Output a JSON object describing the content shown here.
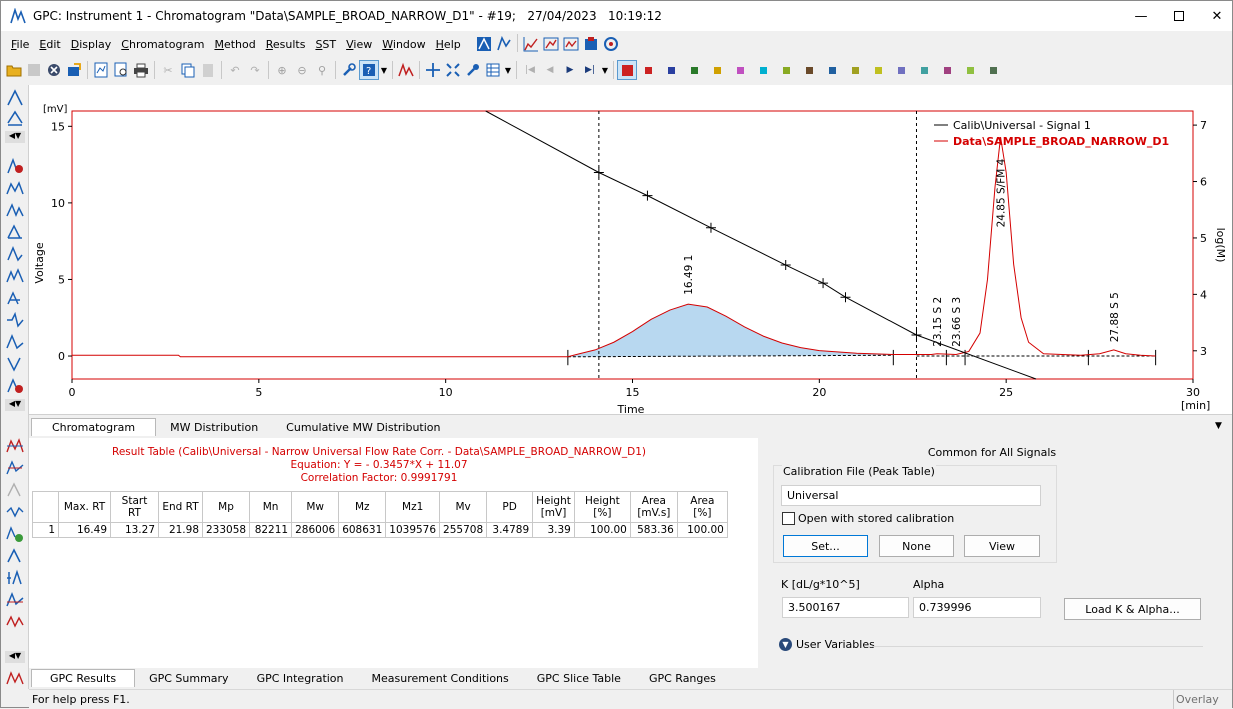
{
  "window": {
    "title": "GPC: Instrument 1 - Chromatogram \"Data\\SAMPLE_BROAD_NARROW_D1\" - #19;   27/04/2023   10:19:12"
  },
  "menu": [
    {
      "label": "File",
      "u": "F"
    },
    {
      "label": "Edit",
      "u": "E"
    },
    {
      "label": "Display",
      "u": "D"
    },
    {
      "label": "Chromatogram",
      "u": "C"
    },
    {
      "label": "Method",
      "u": "M"
    },
    {
      "label": "Results",
      "u": "R"
    },
    {
      "label": "SST",
      "u": "S"
    },
    {
      "label": "View",
      "u": "V"
    },
    {
      "label": "Window",
      "u": "W"
    },
    {
      "label": "Help",
      "u": "H"
    }
  ],
  "colors": {
    "signal_red": "#d40000",
    "accent_blue": "#1a5fb4",
    "fill_blue": "#b8d8f0",
    "result_red": "#d40000",
    "palette": [
      "#cc2222",
      "#2a3fa0",
      "#2a7a2a",
      "#d0a000",
      "#c050c0",
      "#00b0d0",
      "#88aa22",
      "#6a4a2a",
      "#2060a0",
      "#a0a020",
      "#c0c020",
      "#7070c0",
      "#40a0a0",
      "#a04080",
      "#90c040",
      "#507050"
    ]
  },
  "chart": {
    "y_left_unit": "[mV]",
    "y_left_label": "Voltage",
    "y_right_label": "log(M)",
    "x_label": "Time",
    "x_unit": "[min]",
    "x_ticks": [
      "0",
      "5",
      "10",
      "15",
      "20",
      "25",
      "30"
    ],
    "y_ticks": [
      "0",
      "5",
      "10",
      "15"
    ],
    "y2_ticks": [
      "3",
      "4",
      "5",
      "6",
      "7"
    ],
    "legend": [
      "Calib\\Universal - Signal 1",
      "Data\\SAMPLE_BROAD_NARROW_D1"
    ],
    "peak_labels": [
      {
        "rt": "16.49",
        "name": "1"
      },
      {
        "rt": "23.15",
        "name": "S 2"
      },
      {
        "rt": "23.66",
        "name": "S 3"
      },
      {
        "rt": "24.85",
        "name": "S/FM 4"
      },
      {
        "rt": "27.88",
        "name": "S 5"
      }
    ]
  },
  "chart_data": {
    "type": "line",
    "xlim": [
      0,
      30
    ],
    "ylim": [
      -1.5,
      16
    ],
    "y2lim": [
      2.5,
      7.25
    ],
    "series": [
      {
        "name": "Calib\\Universal - Signal 1",
        "axis": "right",
        "x": [
          11.07,
          14.1,
          15.4,
          17.1,
          19.1,
          20.1,
          20.7,
          22.6,
          25.8
        ],
        "y": [
          7.25,
          6.16,
          5.75,
          5.18,
          4.52,
          4.2,
          3.95,
          3.28,
          2.5
        ]
      },
      {
        "name": "Data\\SAMPLE_BROAD_NARROW_D1",
        "axis": "left",
        "x": [
          0,
          2.85,
          2.9,
          13.27,
          13.5,
          14.0,
          14.5,
          15.0,
          15.5,
          16.0,
          16.49,
          17.0,
          17.5,
          18.0,
          18.5,
          19.0,
          19.5,
          20.0,
          21.0,
          21.98,
          23.0,
          23.15,
          23.66,
          24.0,
          24.3,
          24.5,
          24.7,
          24.85,
          25.0,
          25.2,
          25.4,
          25.6,
          26.0,
          27.0,
          27.5,
          27.88,
          28.2,
          28.6,
          29.0
        ],
        "y": [
          0.05,
          0.05,
          -0.05,
          -0.05,
          0.1,
          0.4,
          0.9,
          1.6,
          2.4,
          3.0,
          3.39,
          3.2,
          2.6,
          1.9,
          1.3,
          0.85,
          0.55,
          0.35,
          0.18,
          0.1,
          0.1,
          0.15,
          0.1,
          0.3,
          1.5,
          5.0,
          11.0,
          14.3,
          12.0,
          6.0,
          2.5,
          0.9,
          0.15,
          0.05,
          0.15,
          0.4,
          0.15,
          0.05,
          0.0
        ]
      }
    ],
    "markers_x": [
      14.1,
      15.4,
      17.1,
      19.1,
      20.1,
      20.7,
      22.6
    ],
    "dashed_vlines": [
      14.1,
      22.6
    ]
  },
  "tabs_top": [
    "Chromatogram",
    "MW Distribution",
    "Cumulative MW Distribution"
  ],
  "result": {
    "line1": "Result Table (Calib\\Universal - Narrow Universal Flow Rate Corr. - Data\\SAMPLE_BROAD_NARROW_D1)",
    "line2": "Equation: Y =  - 0.3457*X + 11.07",
    "line3": "Correlation Factor: 0.9991791",
    "headers": [
      "",
      "Max. RT",
      "Start RT",
      "End RT",
      "Mp",
      "Mn",
      "Mw",
      "Mz",
      "Mz1",
      "Mv",
      "PD",
      "Height [mV]",
      "Height [%]",
      "Area [mV.s]",
      "Area [%]"
    ],
    "rows": [
      [
        "1",
        "16.49",
        "13.27",
        "21.98",
        "233058",
        "82211",
        "286006",
        "608631",
        "1039576",
        "255708",
        "3.4789",
        "3.39",
        "100.00",
        "583.36",
        "100.00"
      ]
    ]
  },
  "calib": {
    "title": "Common for All Signals",
    "group": "Calibration File (Peak Table)",
    "file": "Universal",
    "open_stored": "Open with stored calibration",
    "set_btn": "Set...",
    "none_btn": "None",
    "view_btn": "View",
    "k_label": "K [dL/g*10^5]",
    "alpha_label": "Alpha",
    "k_value": "3.500167",
    "alpha_value": "0.739996",
    "load_btn": "Load K & Alpha...",
    "user_vars": "User Variables"
  },
  "tabs_bottom": [
    "GPC Results",
    "GPC Summary",
    "GPC Integration",
    "Measurement Conditions",
    "GPC Slice Table",
    "GPC Ranges"
  ],
  "status": {
    "help": "For help press F1.",
    "mode": "Overlay"
  }
}
